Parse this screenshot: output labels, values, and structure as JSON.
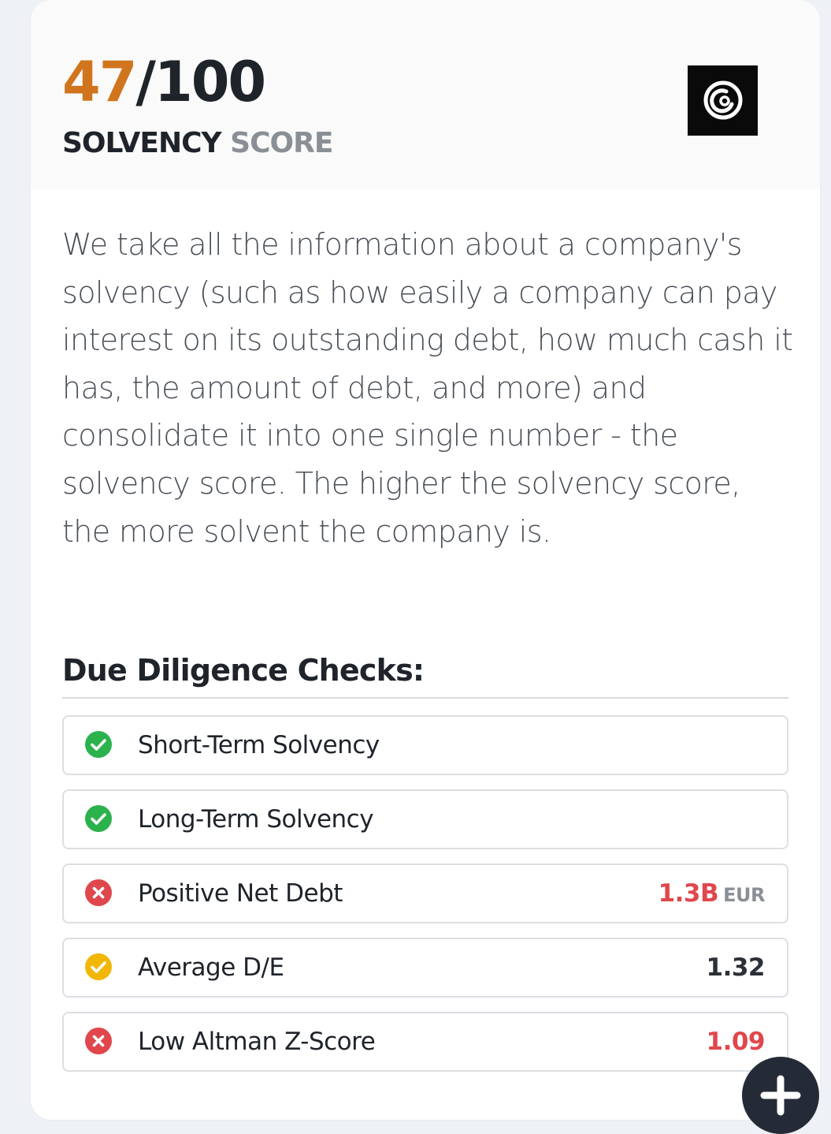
{
  "score": {
    "value": "47",
    "max": "/100",
    "label_primary": "SOLVENCY",
    "label_secondary": "SCORE"
  },
  "logo": {
    "icon": "ubisoft-swirl-icon"
  },
  "description": "We take all the information about a company's solvency (such as how easily a company can pay interest on its outstanding debt, how much cash it has, the amount of debt, and more) and consolidate it into one single number - the solvency score. The higher the solvency score, the more solvent the company is.",
  "checks": {
    "title": "Due Diligence Checks:",
    "items": [
      {
        "label": "Short-Term Solvency",
        "status": "pass",
        "icon": "check-circle-icon"
      },
      {
        "label": "Long-Term Solvency",
        "status": "pass",
        "icon": "check-circle-icon"
      },
      {
        "label": "Positive Net Debt",
        "status": "fail",
        "icon": "x-circle-icon",
        "value": "1.3B",
        "unit": "EUR"
      },
      {
        "label": "Average D/E",
        "status": "warn",
        "icon": "check-circle-icon",
        "value": "1.32"
      },
      {
        "label": "Low Altman Z-Score",
        "status": "fail",
        "icon": "x-circle-icon",
        "value": "1.09"
      }
    ]
  },
  "fab": {
    "icon": "plus-icon"
  },
  "colors": {
    "score_accent": "#d0751e",
    "pass": "#2bb24c",
    "warn": "#f2b705",
    "fail": "#e0474c"
  }
}
